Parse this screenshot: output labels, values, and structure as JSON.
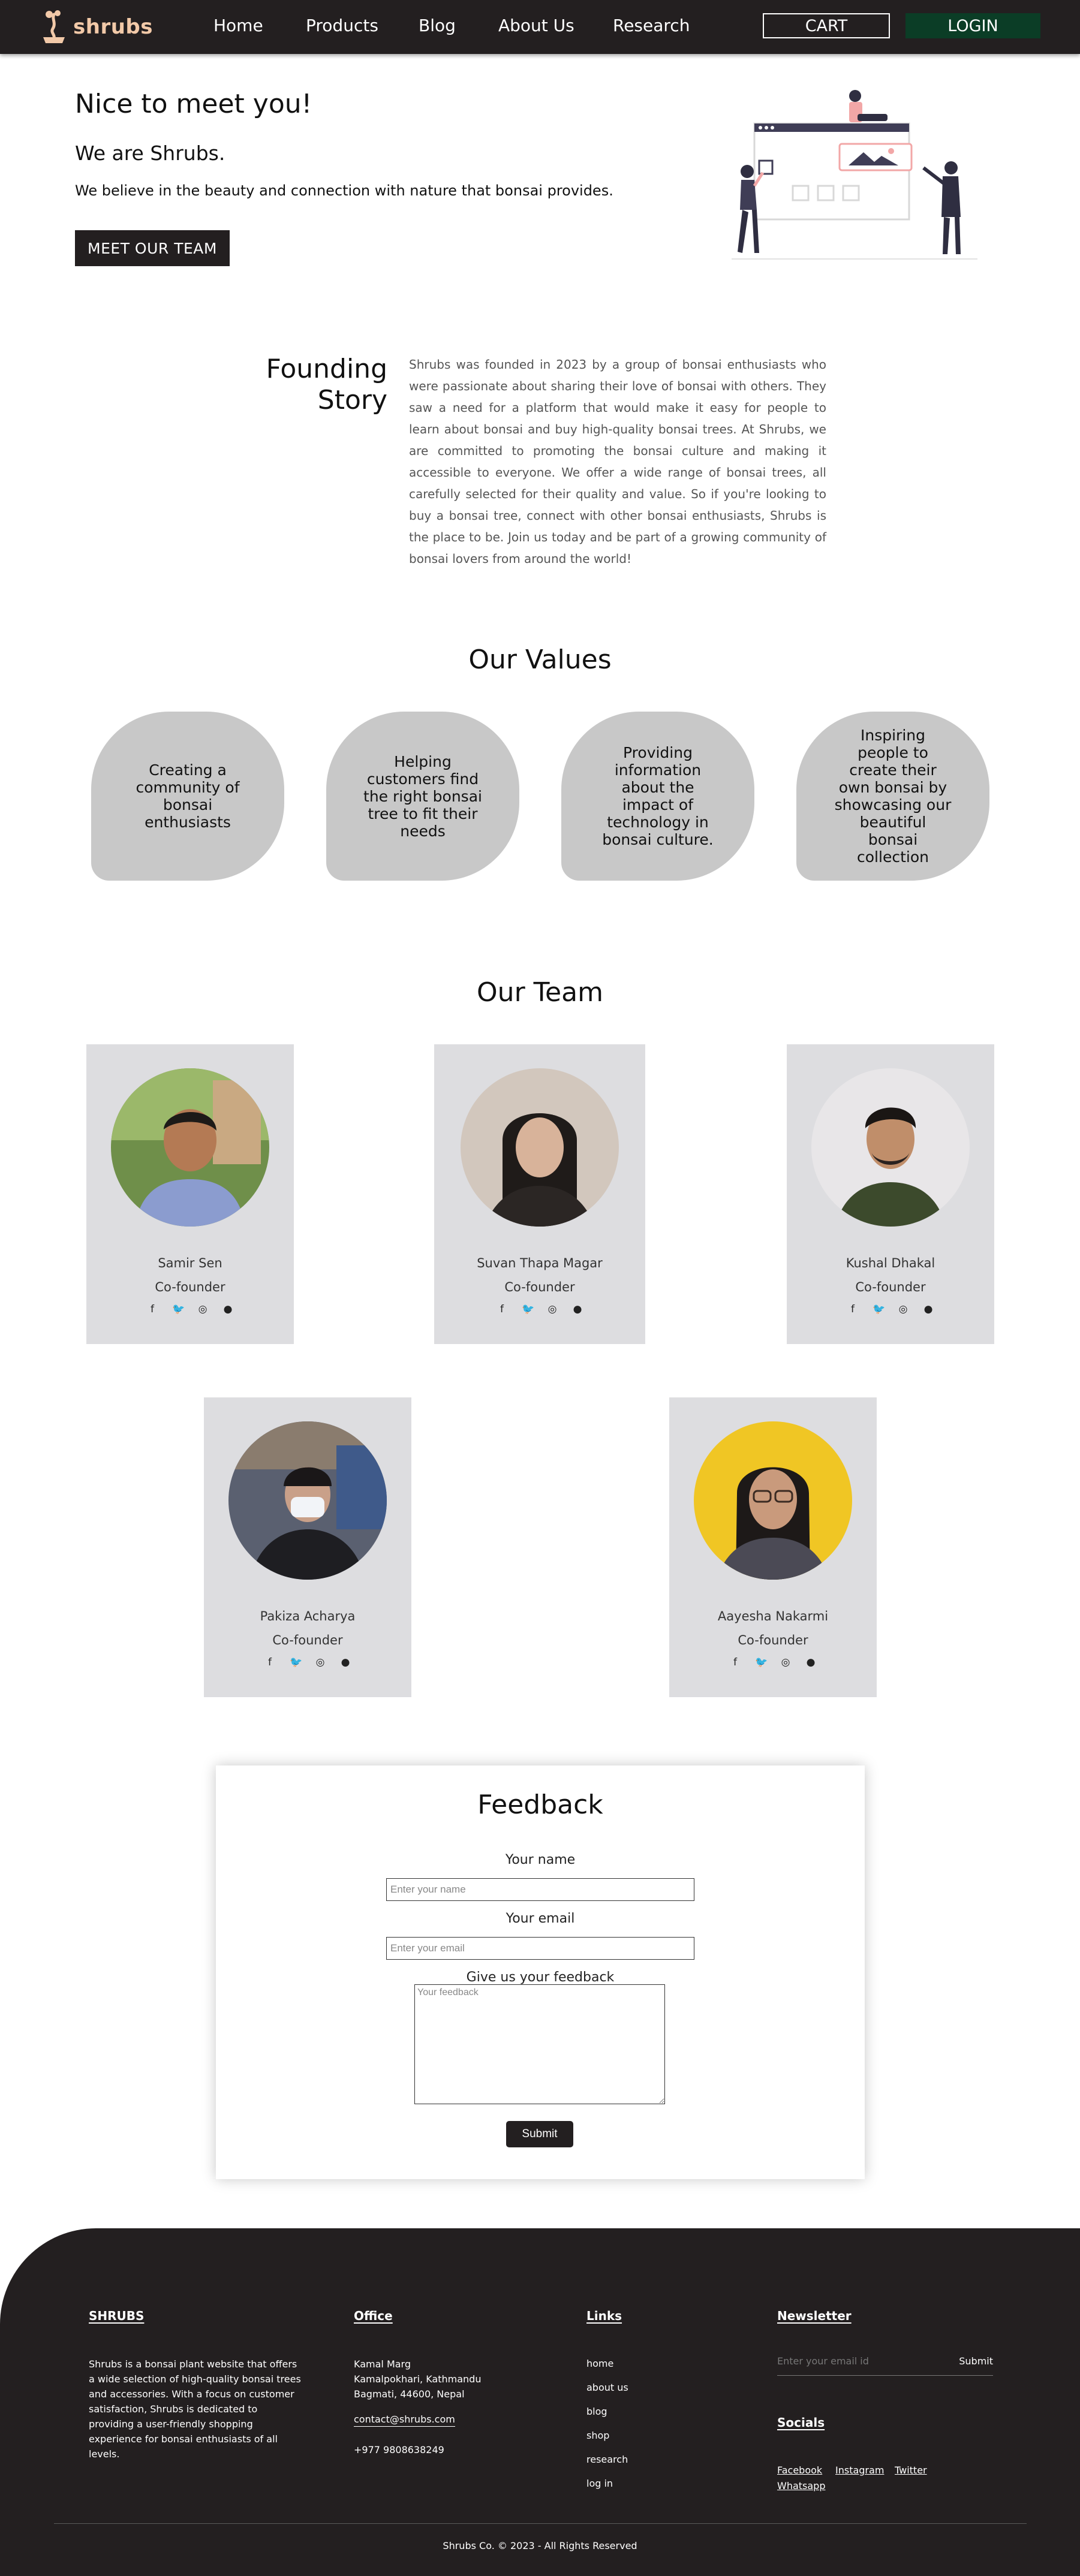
{
  "nav": {
    "brand": "shrubs",
    "links": [
      "Home",
      "Products",
      "Blog",
      "About Us",
      "Research"
    ],
    "cart": "CART",
    "login": "LOGIN"
  },
  "hero": {
    "title": "Nice to meet you!",
    "subtitle": "We are Shrubs.",
    "text": "We believe in the beauty and connection with nature that bonsai provides.",
    "button": "MEET OUR TEAM"
  },
  "founding": {
    "title": "Founding Story",
    "body": "Shrubs was founded in 2023 by a group of bonsai enthusiasts who were passionate about sharing their love of bonsai with others. They saw a need for a platform that would make it easy for people to learn about bonsai and buy high-quality bonsai trees. At Shrubs, we are committed to promoting the bonsai culture and making it accessible to everyone. We offer a wide range of bonsai trees, all carefully selected for their quality and value. So if you're looking to buy a bonsai tree, connect with other bonsai enthusiasts, Shrubs is the place to be. Join us today and be part of a growing community of bonsai lovers from around the world!"
  },
  "values": {
    "title": "Our Values",
    "items": [
      "Creating a community of bonsai enthusiasts",
      "Helping customers find the right bonsai tree to fit their needs",
      "Providing information about the impact of technology in bonsai culture.",
      "Inspiring people to create their own bonsai by showcasing our beautiful bonsai collection"
    ]
  },
  "team": {
    "title": "Our Team",
    "members": [
      {
        "name": "Samir Sen",
        "role": "Co-founder"
      },
      {
        "name": "Suvan Thapa Magar",
        "role": "Co-founder"
      },
      {
        "name": "Kushal Dhakal",
        "role": "Co-founder"
      },
      {
        "name": "Pakiza Acharya",
        "role": "Co-founder"
      },
      {
        "name": "Aayesha Nakarmi",
        "role": "Co-founder"
      }
    ],
    "social_icons": [
      "facebook-icon",
      "twitter-icon",
      "instagram-icon",
      "github-icon"
    ]
  },
  "feedback": {
    "title": "Feedback",
    "name_label": "Your name",
    "name_placeholder": "Enter your name",
    "email_label": "Your email",
    "email_placeholder": "Enter your email",
    "feedback_label": "Give us your feedback",
    "feedback_placeholder": "Your feedback",
    "submit": "Submit"
  },
  "footer": {
    "brand_head": "SHRUBS",
    "brand_text": "Shrubs is a bonsai plant website that offers a wide selection of high-quality bonsai trees and accessories. With a focus on customer satisfaction, Shrubs is dedicated to providing a user-friendly shopping experience for bonsai enthusiasts of all levels.",
    "office_head": "Office",
    "address1": "Kamal Marg",
    "address2": "Kamalpokhari, Kathmandu",
    "address3": "Bagmati, 44600, Nepal",
    "email": "contact@shrubs.com",
    "phone": "+977 9808638249",
    "links_head": "Links",
    "links": [
      "home",
      "about us",
      "blog",
      "shop",
      "research",
      "log in"
    ],
    "newsletter_head": "Newsletter",
    "newsletter_placeholder": "Enter your email id",
    "newsletter_submit": "Submit",
    "socials_head": "Socials",
    "socials": [
      "Facebook",
      "Instagram",
      "Twitter",
      "Whatsapp"
    ],
    "copyright": "Shrubs Co. © 2023 - All Rights Reserved"
  },
  "colors": {
    "dark": "#231f20",
    "login_green": "#0b3d26",
    "brand_peach": "#f2c9a8",
    "card_grey": "#dddde0",
    "value_grey": "#c8c8c8"
  }
}
